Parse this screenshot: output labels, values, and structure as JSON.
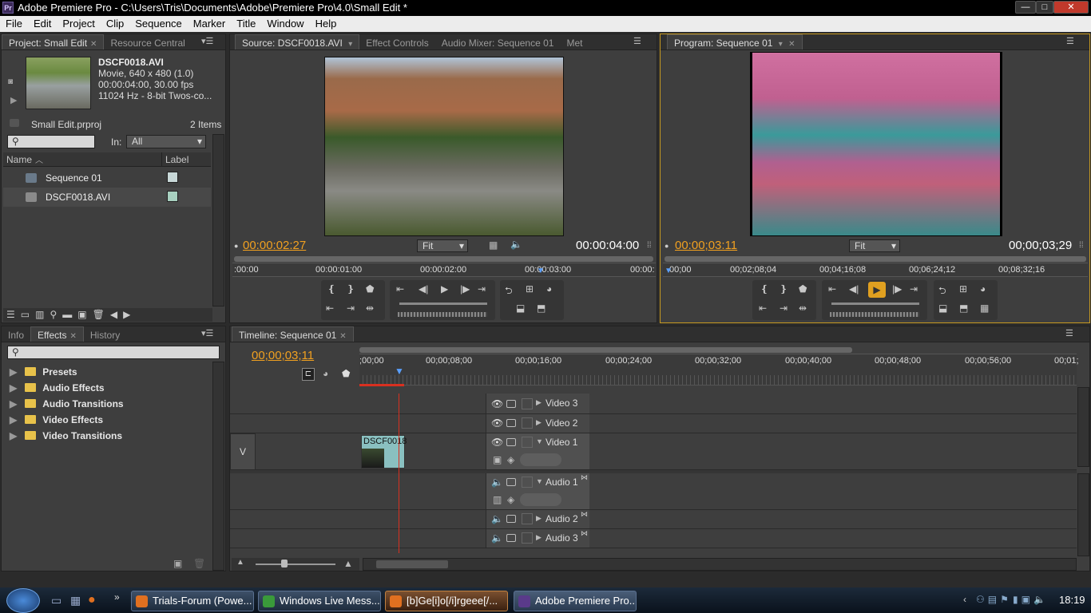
{
  "window": {
    "app_badge": "Pr",
    "title": "Adobe Premiere Pro - C:\\Users\\Tris\\Documents\\Adobe\\Premiere Pro\\4.0\\Small Edit *",
    "min": "—",
    "max": "□",
    "close": "✕"
  },
  "menu": [
    "File",
    "Edit",
    "Project",
    "Clip",
    "Sequence",
    "Marker",
    "Title",
    "Window",
    "Help"
  ],
  "project": {
    "tabs": [
      "Project: Small Edit",
      "Resource Central"
    ],
    "clip_name": "DSCF0018.AVI",
    "clip_info": [
      "Movie, 640 x 480 (1.0)",
      "00:00:04:00, 30.00 fps",
      "11024 Hz - 8-bit Twos-co..."
    ],
    "file": "Small Edit.prproj",
    "count": "2 Items",
    "in_label": "In:",
    "in_value": "All",
    "col_name": "Name",
    "col_label": "Label",
    "items": [
      {
        "name": "Sequence 01",
        "color": "#c8d8d8"
      },
      {
        "name": "DSCF0018.AVI",
        "color": "#a8d0c0"
      }
    ]
  },
  "source": {
    "tabs": [
      "Source: DSCF0018.AVI",
      "Effect Controls",
      "Audio Mixer: Sequence 01",
      "Met"
    ],
    "timecode": "00:00:02:27",
    "fit": "Fit",
    "duration": "00:00:04:00",
    "ruler": [
      ":00:00",
      "00:00:01:00",
      "00:00:02:00",
      "00:00:03:00",
      "00:00:"
    ]
  },
  "program": {
    "tab": "Program: Sequence 01",
    "timecode": "00:00;03:11",
    "fit": "Fit",
    "duration": "00;00;03;29",
    "ruler": [
      "00;00",
      "00;02;08;04",
      "00;04;16;08",
      "00;06;24;12",
      "00;08;32;16"
    ]
  },
  "effects": {
    "tabs": [
      "Info",
      "Effects",
      "History"
    ],
    "folders": [
      "Presets",
      "Audio Effects",
      "Audio Transitions",
      "Video Effects",
      "Video Transitions"
    ]
  },
  "timeline": {
    "tab": "Timeline: Sequence 01",
    "timecode": "00;00;03;11",
    "ruler": [
      ";00;00",
      "00;00;08;00",
      "00;00;16;00",
      "00;00;24;00",
      "00;00;32;00",
      "00;00;40;00",
      "00;00;48;00",
      "00;00;56;00",
      "00;01;"
    ],
    "video_tracks": [
      "Video 3",
      "Video 2",
      "Video 1"
    ],
    "audio_tracks": [
      "Audio 1",
      "Audio 2",
      "Audio 3"
    ],
    "v_tag": "V",
    "clip": "DSCF0018",
    "playhead_color": "#d83020"
  },
  "taskbar": {
    "items": [
      {
        "label": "Trials-Forum (Powe...",
        "color": "#e07020"
      },
      {
        "label": "Windows Live Mess...",
        "color": "#3a9a3a"
      },
      {
        "label": "[b]Ge[i]o[/i]rgeee[/...",
        "color": "#e07020"
      },
      {
        "label": "Adobe Premiere Pro...",
        "color": "#5a3a8a"
      }
    ],
    "clock": "18:19"
  }
}
